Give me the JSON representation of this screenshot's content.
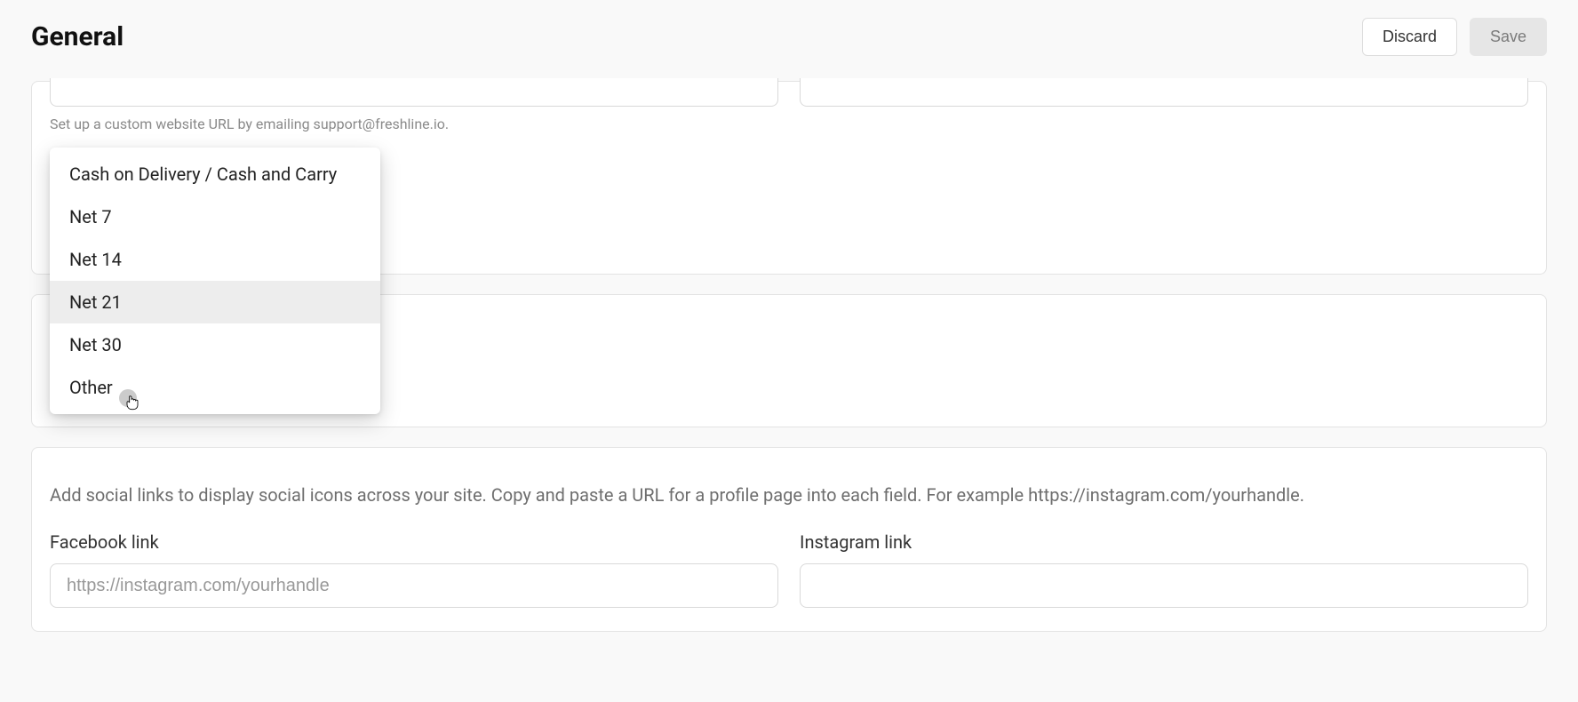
{
  "header": {
    "title": "General",
    "discard_label": "Discard",
    "save_label": "Save"
  },
  "website_url_help": "Set up a custom website URL by emailing support@freshline.io.",
  "dropdown": {
    "options": [
      "Cash on Delivery / Cash and Carry",
      "Net 7",
      "Net 14",
      "Net 21",
      "Net 30",
      "Other"
    ],
    "highlighted_index": 3
  },
  "socials": {
    "description": "Add social links to display social icons across your site. Copy and paste a URL for a profile page into each field. For example https://instagram.com/yourhandle.",
    "facebook": {
      "label": "Facebook link",
      "placeholder": "https://instagram.com/yourhandle",
      "value": ""
    },
    "instagram": {
      "label": "Instagram link",
      "placeholder": "",
      "value": ""
    }
  }
}
